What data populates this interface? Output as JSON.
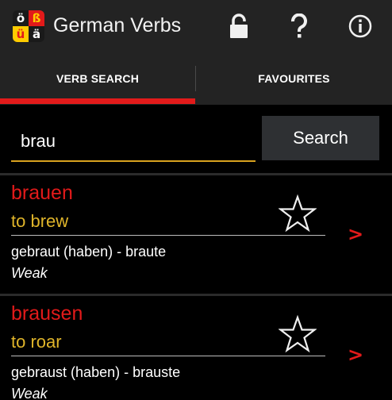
{
  "app": {
    "title": "German Verbs",
    "logo_letters": [
      "ö",
      "ß",
      "ü",
      "ä"
    ],
    "logo_colors": {
      "tl_bg": "#1a1a1a",
      "tl_fg": "#ffffff",
      "tr_bg": "#e21a1a",
      "tr_fg": "#ffcc00",
      "bl_bg": "#ffcc00",
      "bl_fg": "#e21a1a",
      "br_bg": "#1a1a1a",
      "br_fg": "#ffffff"
    }
  },
  "toolbar": {
    "icons": [
      "lock-icon",
      "help-icon",
      "info-icon"
    ]
  },
  "tabs": [
    {
      "label": "VERB SEARCH",
      "active": true
    },
    {
      "label": "FAVOURITES",
      "active": false
    }
  ],
  "search": {
    "value": "brau",
    "button_label": "Search"
  },
  "results": [
    {
      "verb": "brauen",
      "translation": "to brew",
      "forms": "gebraut (haben) - braute",
      "type": "Weak",
      "favourite": false
    },
    {
      "verb": "brausen",
      "translation": "to roar",
      "forms": "gebraust (haben) - brauste",
      "type": "Weak",
      "favourite": false
    }
  ],
  "row_arrow": ">",
  "colors": {
    "accent_red": "#e21a1a",
    "translation_yellow": "#e0b52a",
    "input_underline": "#d8a21f",
    "appbar_bg": "#232323",
    "background": "#000000"
  }
}
